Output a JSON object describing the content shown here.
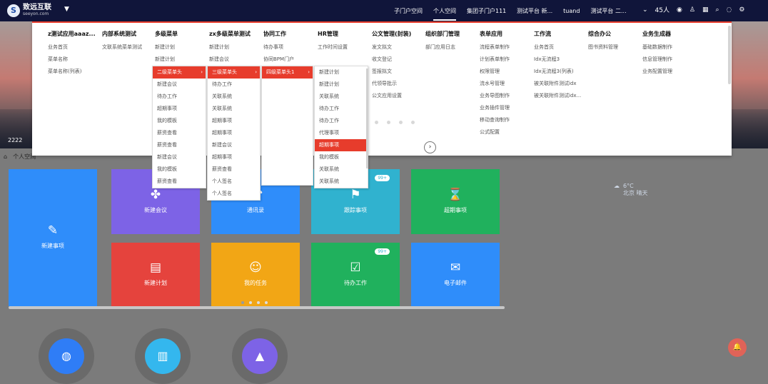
{
  "header": {
    "logo_cn": "致远互联",
    "logo_en": "seeyon.com",
    "nav": [
      "子门户空间",
      "个人空间",
      "集团子门户111",
      "测试平台 新...",
      "tuand",
      "测试平台 二..."
    ],
    "user_count": "45人"
  },
  "hero": {
    "caption": "2222"
  },
  "breadcrumb": {
    "label": "个人空间"
  },
  "mega_menu": {
    "columns": [
      {
        "title": "z测试应用aaaz...",
        "items": [
          "业务首页",
          "菜单名称",
          "菜单名称(列表)"
        ]
      },
      {
        "title": "内部系统测试",
        "items": [
          "文联系统菜单测试"
        ]
      },
      {
        "title": "多级菜单",
        "items": [
          "新建计划",
          "新建计划",
          "",
          "待办工作",
          "待办工作",
          "新建会议",
          "新建会议",
          "新建会议"
        ]
      },
      {
        "title": "zx多级菜单测试",
        "items": [
          "新建计划",
          "新建会议"
        ]
      },
      {
        "title": "协同工作",
        "items": [
          "待办事项",
          "协同BPM门户"
        ]
      },
      {
        "title": "HR管理",
        "items": [
          "工作时间设置"
        ]
      },
      {
        "title": "公文管理(封装)",
        "items": [
          "发文拟文",
          "收文登记",
          "签报拟文",
          "代领导批示",
          "公文应用设置"
        ]
      },
      {
        "title": "组织部门管理",
        "items": [
          "部门应用日志"
        ]
      },
      {
        "title": "表单应用",
        "items": [
          "流程表单制作",
          "计划表单制作",
          "权限管理",
          "流水号管理",
          "业务导图制作",
          "业务插件管理",
          "移动查询制作",
          "公式配置"
        ]
      },
      {
        "title": "工作流",
        "items": [
          "业务首页",
          "Idx无流程3",
          "Idx无流程3(列表)",
          "被关联附件测试idx",
          "被关联附件测试idx..."
        ]
      },
      {
        "title": "综合办公",
        "items": [
          "图书资料管理"
        ]
      },
      {
        "title": "业务生成器",
        "items": [
          "基础数据制作",
          "信息管理制作",
          "业务配置管理"
        ]
      }
    ],
    "submenu_1": [
      {
        "label": "二级菜单头",
        "active": true
      },
      {
        "label": "新建会议"
      },
      {
        "label": "待办工作"
      },
      {
        "label": "超期事项"
      },
      {
        "label": "我的模板"
      },
      {
        "label": "薪资查看"
      },
      {
        "label": "薪资查看"
      },
      {
        "label": "新建会议"
      },
      {
        "label": "我的模板"
      },
      {
        "label": "薪资查看"
      }
    ],
    "submenu_2": [
      {
        "label": "三级菜单头",
        "active": true
      },
      {
        "label": "待办工作"
      },
      {
        "label": "关联系统"
      },
      {
        "label": "关联系统"
      },
      {
        "label": "超期事项"
      },
      {
        "label": "超期事项"
      },
      {
        "label": "新建会议"
      },
      {
        "label": "超期事项"
      },
      {
        "label": "薪资查看"
      },
      {
        "label": "个人签名"
      },
      {
        "label": "个人签名"
      }
    ],
    "submenu_3": [
      {
        "label": "四级菜单头1",
        "active": true
      }
    ],
    "submenu_4": [
      {
        "label": "新建计划"
      },
      {
        "label": "新建计划"
      },
      {
        "label": "关联系统"
      },
      {
        "label": "待办工作"
      },
      {
        "label": "待办工作"
      },
      {
        "label": "代理事项"
      },
      {
        "label": "超期事项",
        "active": true
      },
      {
        "label": "我的模板"
      },
      {
        "label": "关联系统"
      },
      {
        "label": "关联系统"
      }
    ]
  },
  "tiles": [
    {
      "label": "新建事项",
      "color": "#2f8dfa",
      "icon": "✎"
    },
    {
      "label": "新建会议",
      "color": "#7d63e6",
      "icon": "✤"
    },
    {
      "label": "通讯录",
      "color": "#2f8dfa",
      "icon": "☎"
    },
    {
      "label": "跟踪事项",
      "color": "#30b2cf",
      "icon": "⚑",
      "badge": "99+"
    },
    {
      "label": "超期事项",
      "color": "#20b15d",
      "icon": "⌛"
    },
    {
      "label": "新建计划",
      "color": "#e5433d",
      "icon": "▤"
    },
    {
      "label": "我的任务",
      "color": "#f2a615",
      "icon": "☺"
    },
    {
      "label": "待办工作",
      "color": "#20b15d",
      "icon": "☑",
      "badge": "99+"
    },
    {
      "label": "电子邮件",
      "color": "#2f8dfa",
      "icon": "✉"
    }
  ],
  "weather": {
    "temp": "6°C",
    "desc": "北京 晴天"
  }
}
